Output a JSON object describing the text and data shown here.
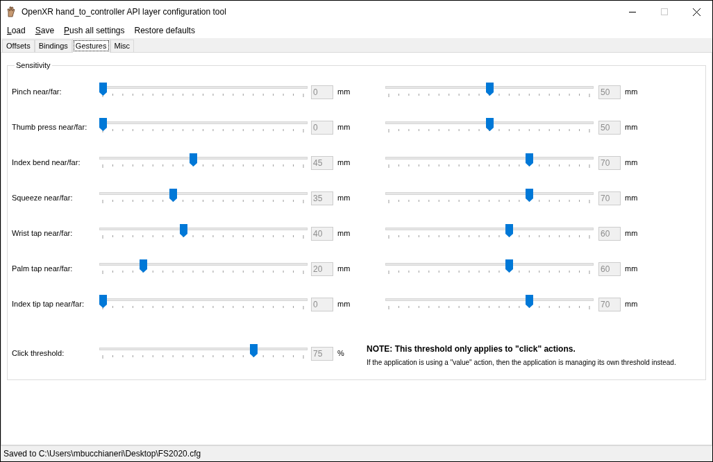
{
  "window": {
    "title": "OpenXR hand_to_controller API layer configuration tool"
  },
  "menu": [
    {
      "label": "Load",
      "underline_first": true
    },
    {
      "label": "Save",
      "underline_first": true
    },
    {
      "label": "Push all settings",
      "underline_first": true
    },
    {
      "label": "Restore defaults",
      "underline_first": false
    }
  ],
  "tabs": [
    {
      "label": "Offsets",
      "selected": false
    },
    {
      "label": "Bindings",
      "selected": false
    },
    {
      "label": "Gestures",
      "selected": true
    },
    {
      "label": "Misc",
      "selected": false
    }
  ],
  "group": {
    "title": "Sensitivity",
    "rows": [
      {
        "label": "Pinch near/far:",
        "near": {
          "level": 0,
          "value": "0",
          "unit": "mm"
        },
        "far": {
          "level": 0.5,
          "value": "50",
          "unit": "mm"
        }
      },
      {
        "label": "Thumb press near/far:",
        "near": {
          "level": 0,
          "value": "0",
          "unit": "mm"
        },
        "far": {
          "level": 0.5,
          "value": "50",
          "unit": "mm"
        }
      },
      {
        "label": "Index bend near/far:",
        "near": {
          "level": 0.45,
          "value": "45",
          "unit": "mm"
        },
        "far": {
          "level": 0.7,
          "value": "70",
          "unit": "mm"
        }
      },
      {
        "label": "Squeeze near/far:",
        "near": {
          "level": 0.35,
          "value": "35",
          "unit": "mm"
        },
        "far": {
          "level": 0.7,
          "value": "70",
          "unit": "mm"
        }
      },
      {
        "label": "Wrist tap near/far:",
        "near": {
          "level": 0.4,
          "value": "40",
          "unit": "mm"
        },
        "far": {
          "level": 0.6,
          "value": "60",
          "unit": "mm"
        }
      },
      {
        "label": "Palm tap near/far:",
        "near": {
          "level": 0.2,
          "value": "20",
          "unit": "mm"
        },
        "far": {
          "level": 0.6,
          "value": "60",
          "unit": "mm"
        }
      },
      {
        "label": "Index tip tap near/far:",
        "near": {
          "level": 0,
          "value": "0",
          "unit": "mm"
        },
        "far": {
          "level": 0.7,
          "value": "70",
          "unit": "mm"
        }
      }
    ],
    "threshold": {
      "label": "Click threshold:",
      "level": 0.75,
      "value": "75",
      "unit": "%",
      "note_title": "NOTE: This threshold only applies to \"click\" actions.",
      "note_text": "If the application is using a \"value\" action, then the application is managing its own threshold instead."
    }
  },
  "status_bar": "Saved to C:\\Users\\mbucchianeri\\Desktop\\FS2020.cfg"
}
